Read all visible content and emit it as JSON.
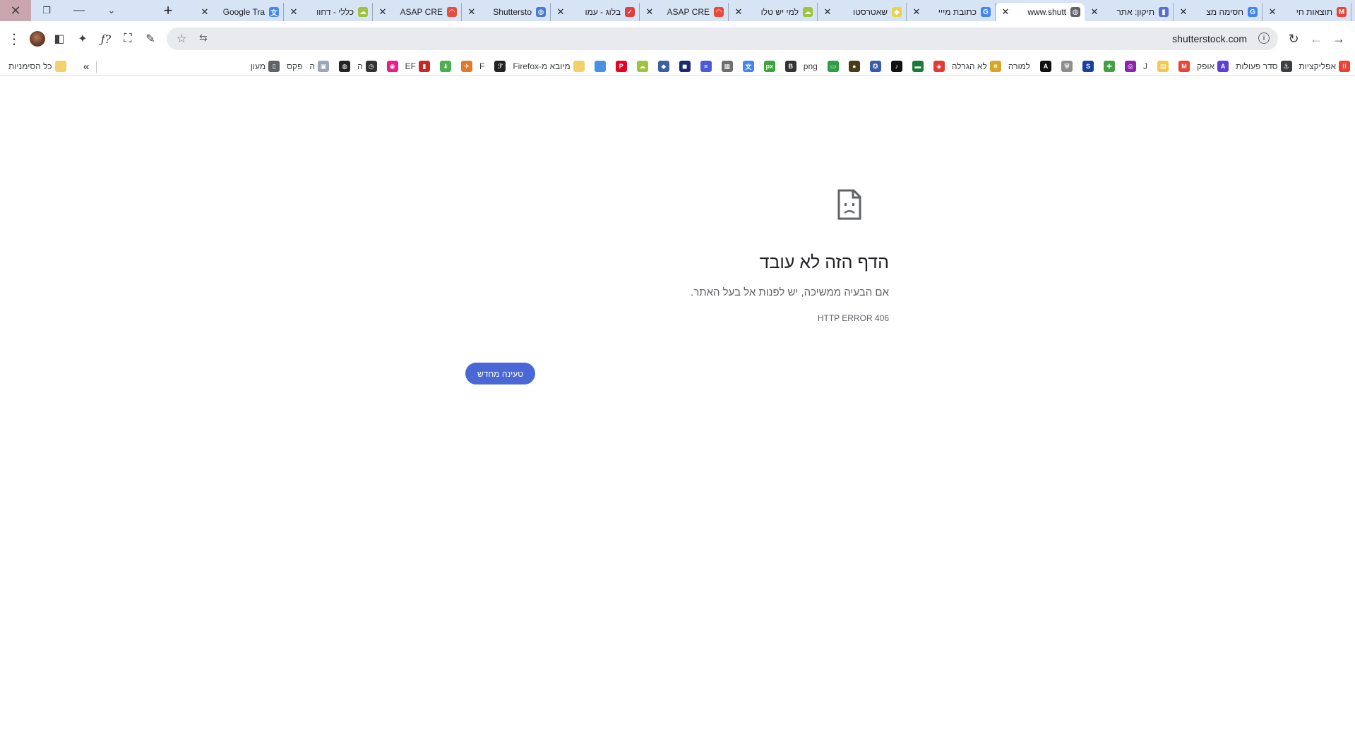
{
  "window": {
    "close_glyph": "✕",
    "restore_glyph": "❐",
    "minimize_glyph": "—",
    "tablist_glyph": "⌄",
    "newtab_glyph": "+"
  },
  "tabs": [
    {
      "title": "תוצאות חי",
      "favicon": "gmail-icon",
      "color": "#ea4335",
      "glyph": "M",
      "active": false
    },
    {
      "title": "חסימה מצ",
      "favicon": "google-icon",
      "color": "#4285f4",
      "glyph": "G",
      "active": false
    },
    {
      "title": "תיקון: אתר",
      "favicon": "doc-icon",
      "color": "#5a6fd6",
      "glyph": "▮",
      "active": false
    },
    {
      "title": "www.shutt",
      "favicon": "globe-icon",
      "color": "#5f6368",
      "glyph": "◍",
      "active": true
    },
    {
      "title": "כתובת מייי",
      "favicon": "google-icon",
      "color": "#4285f4",
      "glyph": "G",
      "active": false
    },
    {
      "title": "שאטרסטו",
      "favicon": "diamond-icon",
      "color": "#e8d24a",
      "glyph": "◆",
      "active": false
    },
    {
      "title": "למי יש טלו",
      "favicon": "cloud-icon",
      "color": "#9bc53d",
      "glyph": "☁",
      "active": false
    },
    {
      "title": "ASAP CRE",
      "favicon": "asap-icon",
      "color": "#e84a3b",
      "glyph": "◠",
      "active": false
    },
    {
      "title": "בלוג - עמו",
      "favicon": "bird-icon",
      "color": "#e0403c",
      "glyph": "✓",
      "active": false
    },
    {
      "title": "Shuttersto",
      "favicon": "globe-icon",
      "color": "#4a7bd0",
      "glyph": "◍",
      "active": false
    },
    {
      "title": "ASAP CRE",
      "favicon": "asap-icon",
      "color": "#e84a3b",
      "glyph": "◠",
      "active": false
    },
    {
      "title": "כללי - דחוו",
      "favicon": "cloud-icon",
      "color": "#9bc53d",
      "glyph": "☁",
      "active": false
    },
    {
      "title": "Google Tra",
      "favicon": "translate-icon",
      "color": "#4285f4",
      "glyph": "文",
      "active": false
    }
  ],
  "toolbar": {
    "menu_glyph": "⋮",
    "sidebar_glyph": "◧",
    "extensions_glyph": "✦",
    "fx_glyph": "ƒ?",
    "capture_glyph": "⛶",
    "eyedropper_glyph": "✎",
    "back_glyph": "→",
    "forward_glyph": "←",
    "reload_glyph": "↻",
    "url": "shutterstock.com",
    "info_glyph": "i",
    "star_glyph": "☆",
    "share_glyph": "⇆"
  },
  "bookmarks": {
    "overflow_glyph": "»",
    "items": [
      {
        "label": "אפליקציות",
        "icon": "apps-grid-icon",
        "color": "#ea4335",
        "glyph": "⁞⁞"
      },
      {
        "label": "סדר פעולות",
        "icon": "anchor-icon",
        "color": "#3c4043",
        "glyph": "⚓"
      },
      {
        "label": "אופק",
        "icon": "ofek-icon",
        "color": "#5b3fd6",
        "glyph": "A"
      },
      {
        "label": "",
        "icon": "gmail-icon",
        "color": "#ea4335",
        "glyph": "M"
      },
      {
        "label": "",
        "icon": "note-icon",
        "color": "#f2c94c",
        "glyph": "▤"
      },
      {
        "label": "J",
        "icon": "j-icon",
        "color": "#ffffff",
        "glyph": ""
      },
      {
        "label": "",
        "icon": "circle-purple-icon",
        "color": "#8e24aa",
        "glyph": "◎"
      },
      {
        "label": "",
        "icon": "puzzle-green-icon",
        "color": "#43a047",
        "glyph": "✚"
      },
      {
        "label": "",
        "icon": "s-icon",
        "color": "#1a3f9e",
        "glyph": "S"
      },
      {
        "label": "",
        "icon": "shield-icon",
        "color": "#8d8d8d",
        "glyph": "⛨"
      },
      {
        "label": "",
        "icon": "a-black-icon",
        "color": "#111111",
        "glyph": "A"
      },
      {
        "label": "למורה",
        "icon": "teacher-icon",
        "color": "#ffffff",
        "glyph": ""
      },
      {
        "label": "לא הגרלה",
        "icon": "star-icon",
        "color": "#d4a72c",
        "glyph": "✵"
      },
      {
        "label": "",
        "icon": "red-square-icon",
        "color": "#e53935",
        "glyph": "◈"
      },
      {
        "label": "",
        "icon": "green-card-icon",
        "color": "#1b7a3a",
        "glyph": "▬"
      },
      {
        "label": "",
        "icon": "tiktok-icon",
        "color": "#111111",
        "glyph": "♪"
      },
      {
        "label": "",
        "icon": "badge-icon",
        "color": "#3b5cad",
        "glyph": "✪"
      },
      {
        "label": "",
        "icon": "lock-gold-icon",
        "color": "#4a3b18",
        "glyph": "●"
      },
      {
        "label": "",
        "icon": "green-pill-icon",
        "color": "#2e9e45",
        "glyph": "▭"
      },
      {
        "label": "png",
        "icon": "png-icon",
        "color": "#ffffff",
        "glyph": ""
      },
      {
        "label": "",
        "icon": "big-icon",
        "color": "#333333",
        "glyph": "B"
      },
      {
        "label": "",
        "icon": "px-icon",
        "color": "#3aa53a",
        "glyph": "px"
      },
      {
        "label": "",
        "icon": "translate-icon",
        "color": "#4285f4",
        "glyph": "文"
      },
      {
        "label": "",
        "icon": "calendar-icon",
        "color": "#6e6e6e",
        "glyph": "▦"
      },
      {
        "label": "",
        "icon": "forms-icon",
        "color": "#4b5bd7",
        "glyph": "≡"
      },
      {
        "label": "",
        "icon": "dark-blue-icon",
        "color": "#1a2b6d",
        "glyph": "◼"
      },
      {
        "label": "",
        "icon": "cube-icon",
        "color": "#3b5fa0",
        "glyph": "◆"
      },
      {
        "label": "",
        "icon": "cloud-icon",
        "color": "#9bc53d",
        "glyph": "☁"
      },
      {
        "label": "",
        "icon": "pinterest-icon",
        "color": "#e60023",
        "glyph": "P"
      },
      {
        "label": "",
        "icon": "blue-square-icon",
        "color": "#4a90e2",
        "glyph": ""
      },
      {
        "label": "מיובא מ-Firefox",
        "icon": "folder-icon",
        "color": "#f2d16b",
        "glyph": ""
      },
      {
        "label": "",
        "icon": "script-f-icon",
        "color": "#222222",
        "glyph": "ℱ"
      },
      {
        "label": "F",
        "icon": "f-icon",
        "color": "#ffffff",
        "glyph": ""
      },
      {
        "label": "",
        "icon": "plane-icon",
        "color": "#e07a2a",
        "glyph": "✈"
      },
      {
        "label": "",
        "icon": "download-green-icon",
        "color": "#4caf50",
        "glyph": "⬇"
      },
      {
        "label": "EF",
        "icon": "ef-icon",
        "color": "#c62828",
        "glyph": "▮"
      },
      {
        "label": "",
        "icon": "pink-circle-icon",
        "color": "#e91e8c",
        "glyph": "◉"
      },
      {
        "label": "ה",
        "icon": "clock-icon",
        "color": "#333333",
        "glyph": "◷"
      },
      {
        "label": "",
        "icon": "globe-dark-icon",
        "color": "#222222",
        "glyph": "◍"
      },
      {
        "label": "ה",
        "icon": "image-icon",
        "color": "#9aa7b8",
        "glyph": "▣"
      },
      {
        "label": "פקס",
        "icon": "fax-icon",
        "color": "#ffffff",
        "glyph": ""
      },
      {
        "label": "מעון",
        "icon": "page-icon",
        "color": "#5f6368",
        "glyph": "▯"
      }
    ],
    "all_bookmarks_label": "כל הסימניות"
  },
  "error_page": {
    "icon": "sad-page-icon",
    "title": "הדף הזה לא עובד",
    "message": "אם הבעיה ממשיכה, יש לפנות אל בעל האתר.",
    "code": "HTTP ERROR 406",
    "reload_label": "טעינה מחדש"
  }
}
